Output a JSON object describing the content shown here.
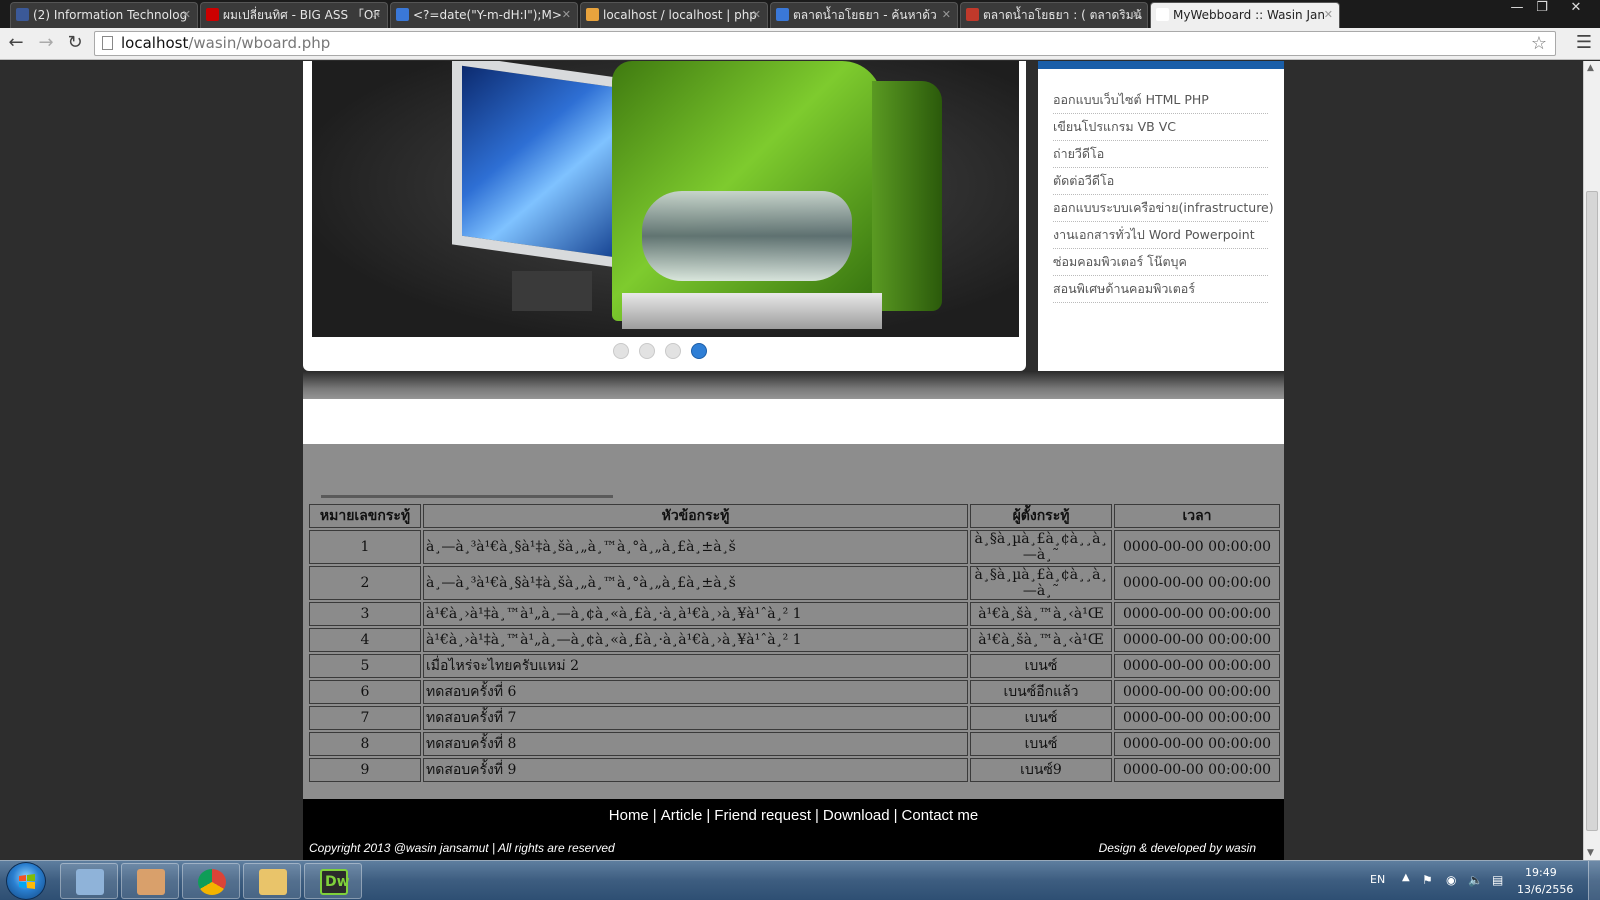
{
  "browser": {
    "tabs": [
      {
        "title": "(2) Information Technolog",
        "favicon_color": "#3b5998",
        "favicon": "facebook-icon"
      },
      {
        "title": "ผมเปลี่ยนทิศ - BIG ASS 「OF",
        "favicon_color": "#cc0000",
        "favicon": "youtube-icon"
      },
      {
        "title": "<?=date(\"Y-m-dH:I\");M>",
        "favicon_color": "#3a78d8",
        "favicon": "google-icon"
      },
      {
        "title": "localhost / localhost | php",
        "favicon_color": "#e8a33d",
        "favicon": "phpmyadmin-icon"
      },
      {
        "title": "ตลาดน้ำอโยธยา - ค้นหาด้ว",
        "favicon_color": "#3a78d8",
        "favicon": "google-icon"
      },
      {
        "title": "ตลาดน้ำอโยธยา : ( ตลาดริมน้",
        "favicon_color": "#c0392b",
        "favicon": "site-icon"
      },
      {
        "title": "MyWebboard :: Wasin Jan",
        "favicon_color": "#ffffff",
        "favicon": "page-icon"
      }
    ],
    "active_tab": 6,
    "url_host": "localhost",
    "url_path": "/wasin/wboard.php"
  },
  "slider": {
    "dots": 4,
    "active_dot": 3
  },
  "services": {
    "items": [
      "ออกแบบเว็บไซต์ HTML PHP",
      "เขียนโปรแกรม VB VC",
      "ถ่ายวีดีโอ",
      "ตัดต่อวีดีโอ",
      "ออกแบบระบบเครือข่าย(infrastructure)",
      "งานเอกสารทั่วไป Word Powerpoint",
      "ซ่อมคอมพิวเตอร์ โน๊ตบุค",
      "สอนพิเศษด้านคอมพิวเตอร์"
    ]
  },
  "board": {
    "headers": [
      "หมายเลขกระทู้",
      "หัวข้อกระทู้",
      "ผู้ตั้งกระทู้",
      "เวลา"
    ],
    "rows": [
      {
        "id": "1",
        "topic": "à¸—à¸³à¹€à¸§à¹‡à¸šà¸„à¸™à¸°à¸„à¸£à¸±à¸š",
        "author": "à¸§à¸µà¸£à¸¢à¸¸à¸—à¸˜",
        "time": "0000-00-00 00:00:00"
      },
      {
        "id": "2",
        "topic": "à¸—à¸³à¹€à¸§à¹‡à¸šà¸„à¸™à¸°à¸„à¸£à¸±à¸š",
        "author": "à¸§à¸µà¸£à¸¢à¸¸à¸—à¸˜",
        "time": "0000-00-00 00:00:00"
      },
      {
        "id": "3",
        "topic": "à¹€à¸›à¹‡à¸™à¹„à¸—à¸¢à¸«à¸£à¸·à¸­à¹€à¸›à¸¥à¹ˆà¸² 1",
        "author": "à¹€à¸šà¸™à¸‹à¹Œ",
        "time": "0000-00-00 00:00:00"
      },
      {
        "id": "4",
        "topic": "à¹€à¸›à¹‡à¸™à¹„à¸—à¸¢à¸«à¸£à¸·à¸­à¹€à¸›à¸¥à¹ˆà¸² 1",
        "author": "à¹€à¸šà¸™à¸‹à¹Œ",
        "time": "0000-00-00 00:00:00"
      },
      {
        "id": "5",
        "topic": "เมื่อไหร่จะไทยครับแหม่ 2",
        "author": "เบนซ์",
        "time": "0000-00-00 00:00:00"
      },
      {
        "id": "6",
        "topic": "ทดสอบครั้งที่ 6",
        "author": "เบนซ์อีกแล้ว",
        "time": "0000-00-00 00:00:00"
      },
      {
        "id": "7",
        "topic": "ทดสอบครั้งที่ 7",
        "author": "เบนซ์",
        "time": "0000-00-00 00:00:00"
      },
      {
        "id": "8",
        "topic": "ทดสอบครั้งที่ 8",
        "author": "เบนซ์",
        "time": "0000-00-00 00:00:00"
      },
      {
        "id": "9",
        "topic": "ทดสอบครั้งที่ 9",
        "author": "เบนซ์9",
        "time": "0000-00-00 00:00:00"
      }
    ]
  },
  "footer": {
    "nav": [
      "Home",
      "Article",
      "Friend request",
      "Download",
      "Contact me"
    ],
    "separator": "|",
    "copyright": "Copyright 2013 @wasin jansamut  |  All rights are reserved",
    "designed_by": "Design & developed by wasin"
  },
  "taskbar": {
    "apps": [
      "calculator-icon",
      "game-character-icon",
      "chrome-icon",
      "explorer-folder-icon",
      "dreamweaver-icon"
    ],
    "dreamweaver_label": "Dw",
    "language": "EN",
    "time": "19:49",
    "date": "13/6/2556"
  },
  "colors": {
    "accent": "#1a5ea8",
    "slider_active_dot": "#2f7fd6",
    "footer_bg": "#000000",
    "page_bg": "#2d2d2d"
  }
}
